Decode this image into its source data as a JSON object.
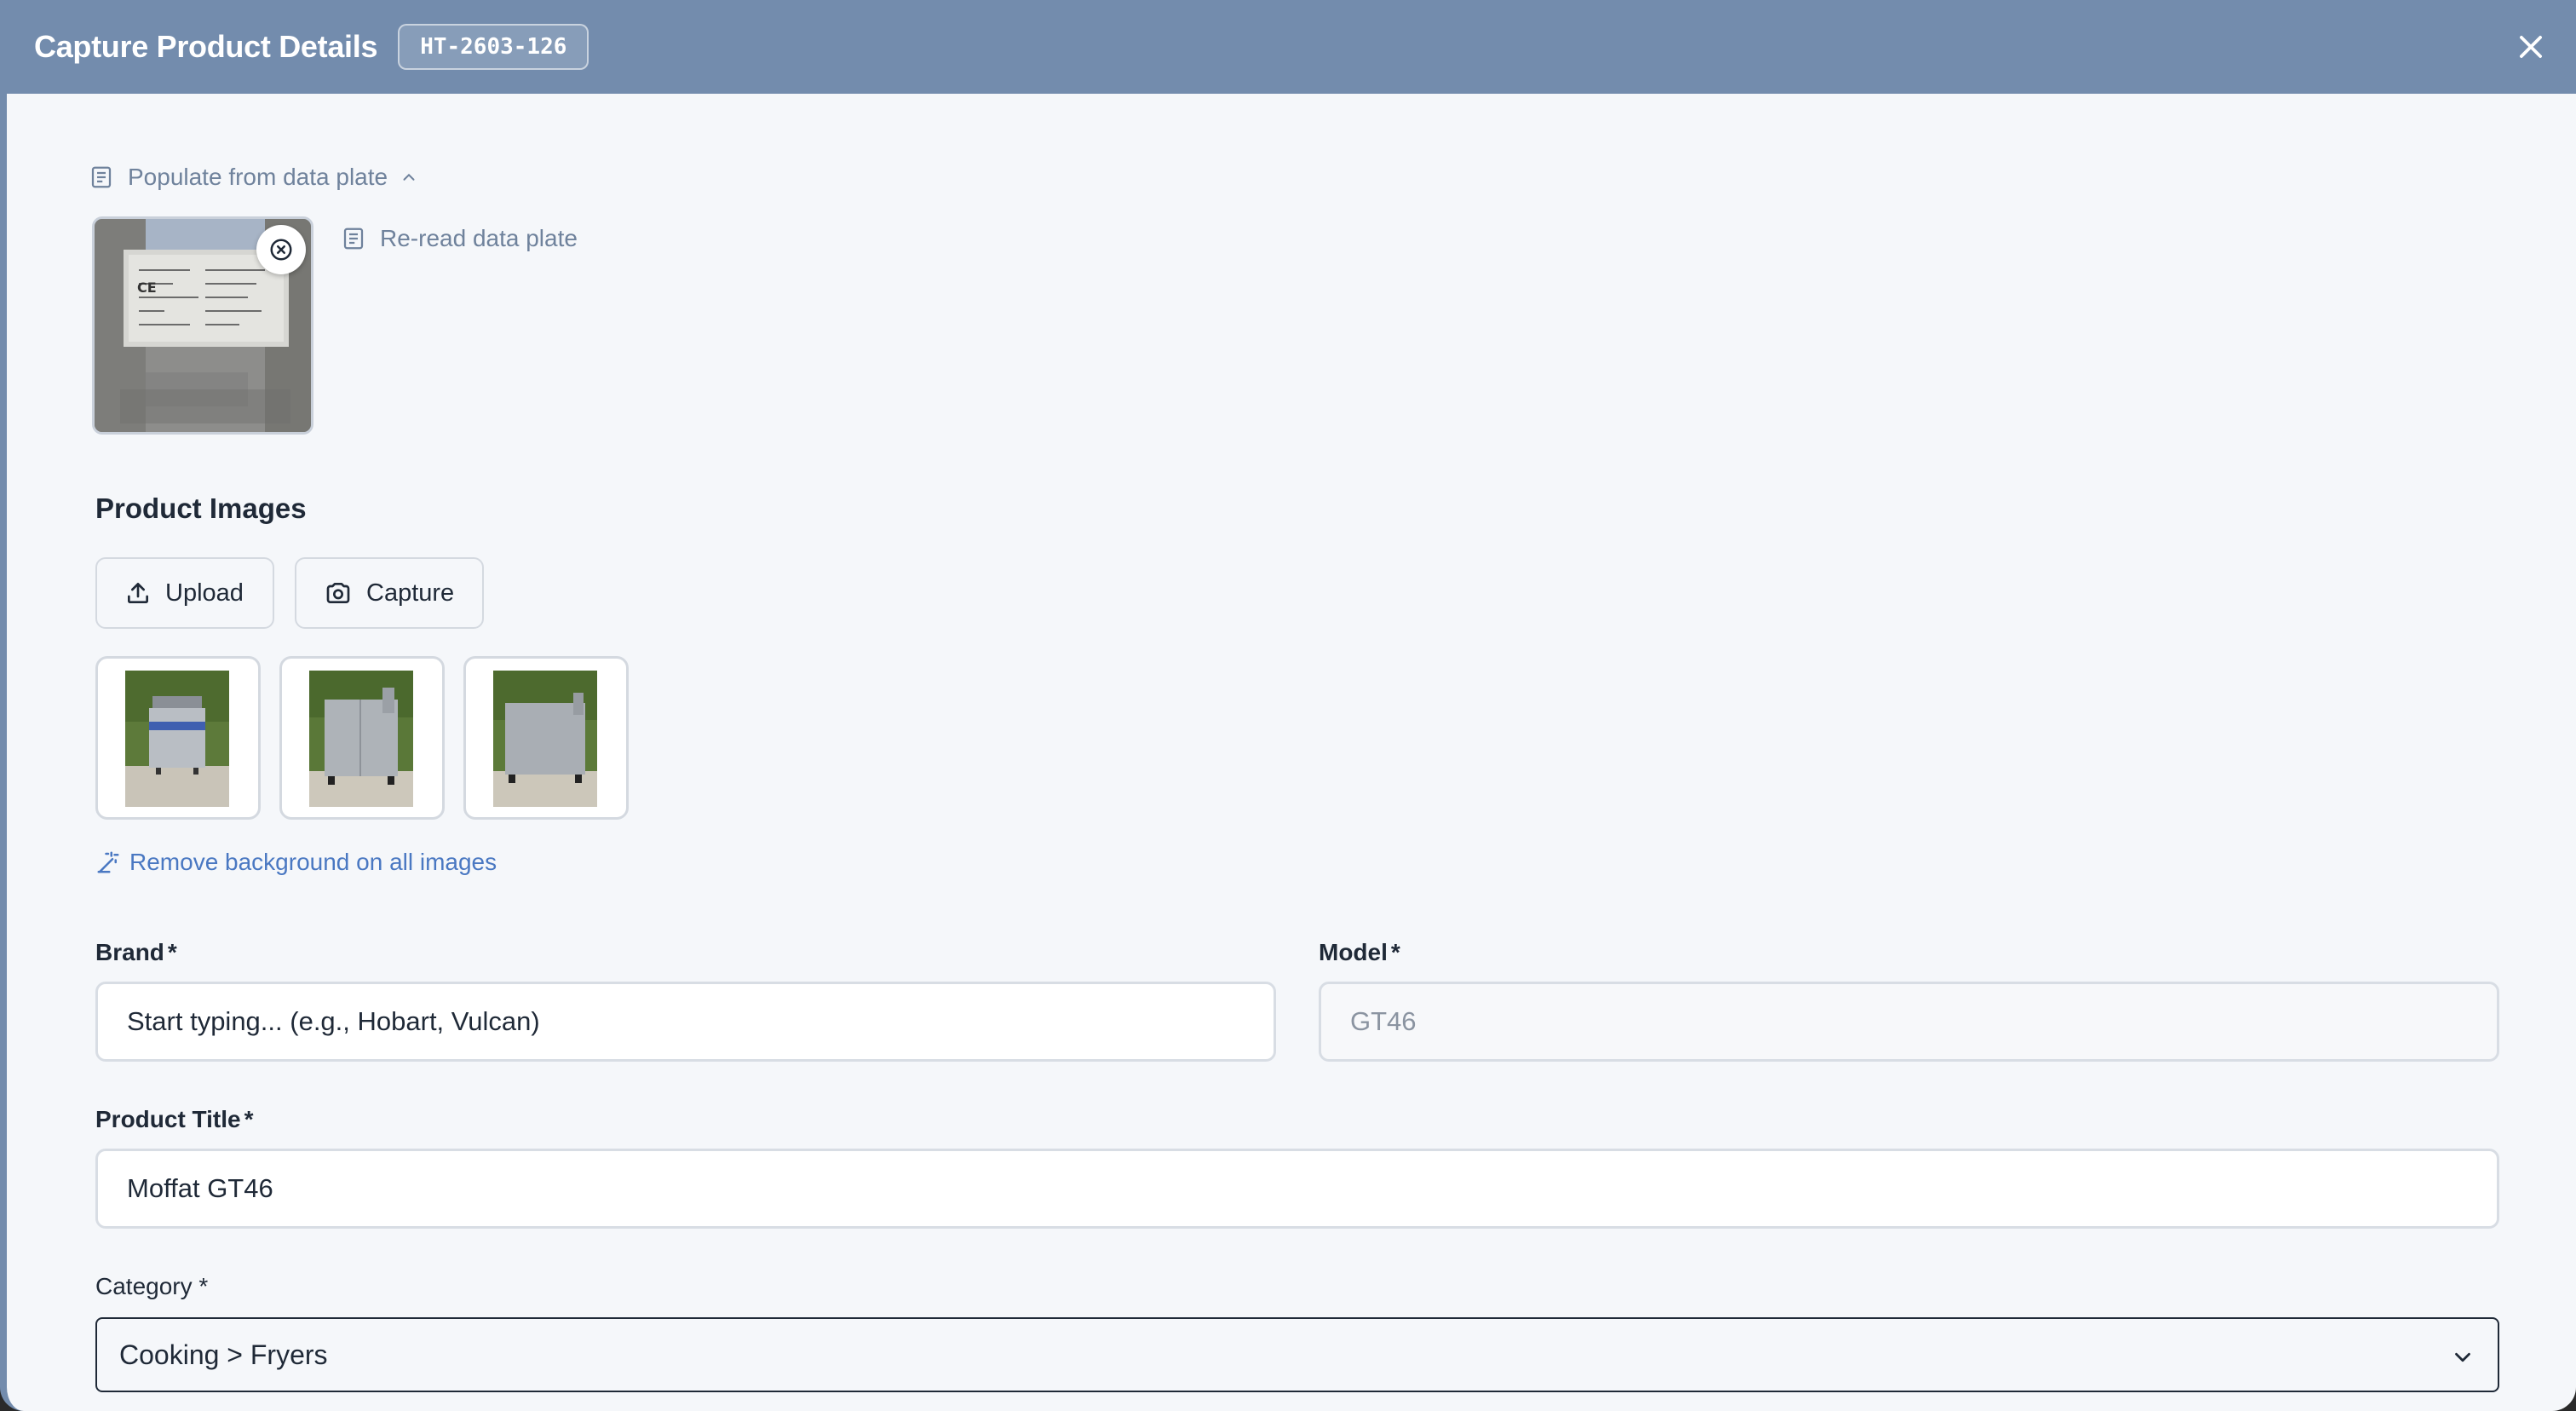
{
  "header": {
    "title": "Capture Product Details",
    "badge": "HT-2603-126"
  },
  "data_plate": {
    "toggle_label": "Populate from data plate",
    "reread_label": "Re-read data plate"
  },
  "product_images": {
    "title": "Product Images",
    "upload_label": "Upload",
    "capture_label": "Capture",
    "remove_background_label": "Remove background on all images"
  },
  "form": {
    "brand": {
      "label": "Brand",
      "required": "*",
      "placeholder": "Start typing... (e.g., Hobart, Vulcan)",
      "value": ""
    },
    "model": {
      "label": "Model",
      "required": "*",
      "value": "GT46"
    },
    "title": {
      "label": "Product Title",
      "required": "*",
      "value": "Moffat GT46"
    },
    "category": {
      "label": "Category *",
      "value": "Cooking > Fryers"
    }
  },
  "colors": {
    "header_bg": "#738cad",
    "link_muted": "#6f829c",
    "link_accent": "#4a78c2"
  }
}
